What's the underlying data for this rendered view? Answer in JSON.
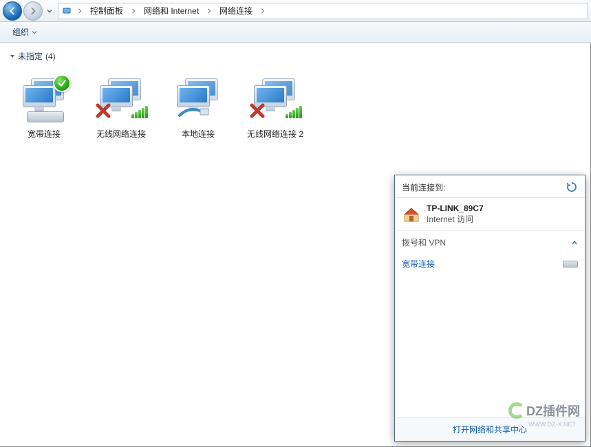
{
  "navbar": {
    "crumbs": [
      "控制面板",
      "网络和 Internet",
      "网络连接"
    ]
  },
  "toolbar": {
    "organize": "组织"
  },
  "group": {
    "label": "未指定",
    "count": "(4)"
  },
  "connections": [
    {
      "label": "宽带连接",
      "type": "broadband"
    },
    {
      "label": "无线网络连接",
      "type": "wireless-x"
    },
    {
      "label": "本地连接",
      "type": "ethernet"
    },
    {
      "label": "无线网络连接 2",
      "type": "wireless-x"
    }
  ],
  "flyout": {
    "title": "当前连接到:",
    "network_name": "TP-LINK_89C7",
    "network_status": "Internet 访问",
    "section_dial": "拨号和 VPN",
    "dial_item": "宽带连接",
    "footer": "打开网络和共享中心"
  },
  "watermark": {
    "text": "DZ插件网",
    "sub": "WWW.DZ-X.NET"
  }
}
